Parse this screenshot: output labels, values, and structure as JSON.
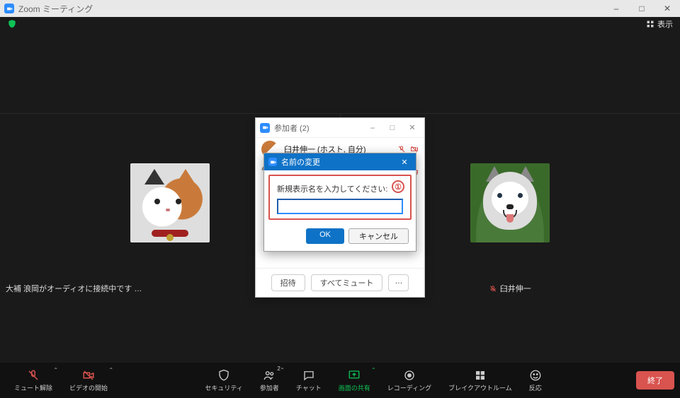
{
  "window": {
    "title": "Zoom ミーティング",
    "minimize": "–",
    "maximize": "□",
    "close": "✕"
  },
  "topbar": {
    "view_label": "表示"
  },
  "participants_panel": {
    "title": "参加者 (2)",
    "minimize": "–",
    "maximize": "□",
    "close": "✕",
    "list": [
      {
        "name": "臼井伸一 (ホスト, 自分)"
      },
      {
        "name": "大補 浪岡"
      }
    ],
    "footer": {
      "invite": "招待",
      "mute_all": "すべてミュート",
      "more": "…"
    }
  },
  "rename_dialog": {
    "title": "名前の変更",
    "close": "✕",
    "prompt": "新規表示名を入力してください:",
    "input_value": "",
    "ok": "OK",
    "cancel": "キャンセル",
    "annotation": "①"
  },
  "video_panes": {
    "left_label": "大補 浪岡がオーディオに接続中です …",
    "right_label": "臼井伸一"
  },
  "toolbar": {
    "mute": "ミュート解除",
    "video": "ビデオの開始",
    "security": "セキュリティ",
    "participants": "参加者",
    "participants_count": "2",
    "chat": "チャット",
    "share": "画面の共有",
    "record": "レコーディング",
    "breakout": "ブレイクアウトルーム",
    "reactions": "反応",
    "end": "終了"
  }
}
